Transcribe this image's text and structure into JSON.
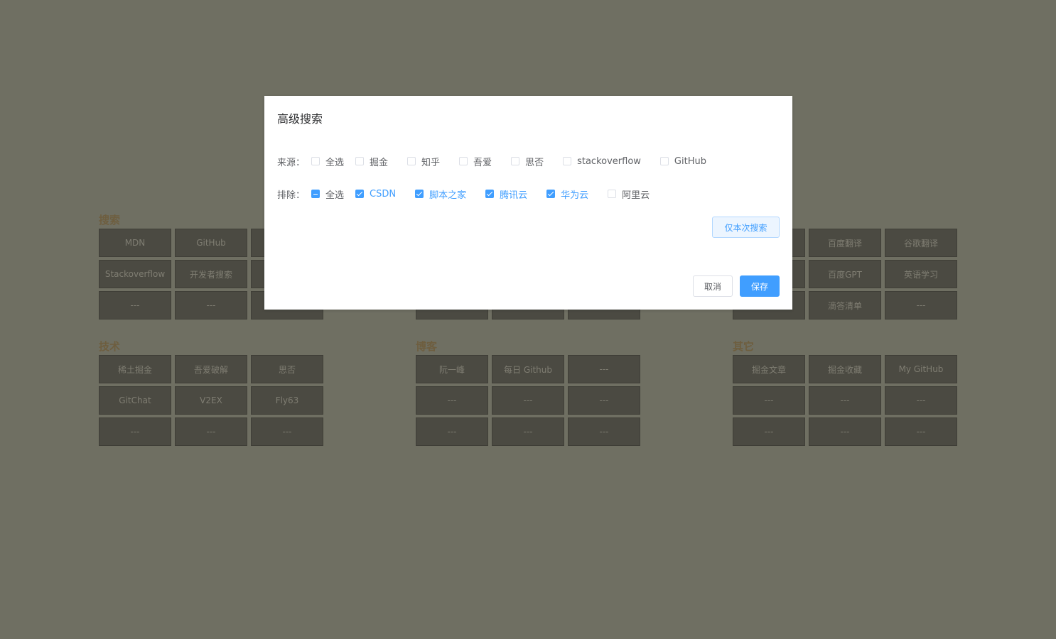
{
  "groups": [
    {
      "title": "搜索",
      "tiles": [
        "MDN",
        "GitHub",
        "",
        "Stackoverflow",
        "开发者搜索",
        "",
        "---",
        "---",
        ""
      ]
    },
    {
      "title": "",
      "tiles": [
        "",
        "",
        "",
        "",
        "",
        "",
        "",
        "",
        ""
      ]
    },
    {
      "title": "",
      "tiles": [
        "",
        "百度翻译",
        "谷歌翻译",
        "",
        "百度GPT",
        "英语学习",
        "",
        "滴答清单",
        "---"
      ]
    },
    {
      "title": "技术",
      "tiles": [
        "稀土掘金",
        "吾爱破解",
        "思否",
        "GitChat",
        "V2EX",
        "Fly63",
        "---",
        "---",
        "---"
      ]
    },
    {
      "title": "博客",
      "tiles": [
        "阮一峰",
        "每日 Github",
        "---",
        "---",
        "---",
        "---",
        "---",
        "---",
        "---"
      ]
    },
    {
      "title": "其它",
      "tiles": [
        "掘金文章",
        "掘金收藏",
        "My GitHub",
        "---",
        "---",
        "---",
        "---",
        "---",
        "---"
      ]
    }
  ],
  "dialog": {
    "title": "高级搜索",
    "source_label": "来源：",
    "sources": [
      {
        "label": "全选",
        "state": "unchecked"
      },
      {
        "label": "掘金",
        "state": "unchecked"
      },
      {
        "label": "知乎",
        "state": "unchecked"
      },
      {
        "label": "吾爱",
        "state": "unchecked"
      },
      {
        "label": "思否",
        "state": "unchecked"
      },
      {
        "label": "stackoverflow",
        "state": "unchecked"
      },
      {
        "label": "GitHub",
        "state": "unchecked"
      }
    ],
    "exclude_label": "排除：",
    "excludes": [
      {
        "label": "全选",
        "state": "indeterminate"
      },
      {
        "label": "CSDN",
        "state": "checked"
      },
      {
        "label": "脚本之家",
        "state": "checked"
      },
      {
        "label": "腾讯云",
        "state": "checked"
      },
      {
        "label": "华为云",
        "state": "checked"
      },
      {
        "label": "阿里云",
        "state": "unchecked"
      }
    ],
    "search_once_label": "仅本次搜索",
    "cancel_label": "取消",
    "save_label": "保存"
  },
  "colors": {
    "accent": "#409eff",
    "overlay": "#6f6f62",
    "tile": "#4b4a42",
    "group_title": "#6e5e3f"
  }
}
